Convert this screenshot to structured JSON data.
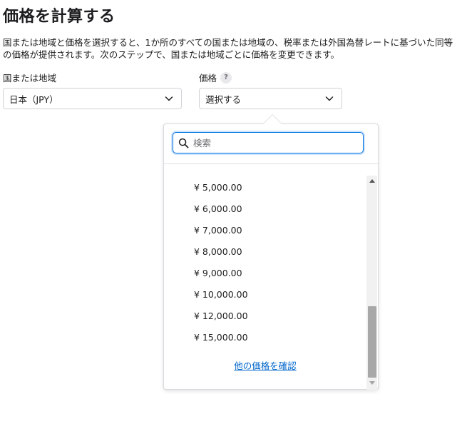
{
  "page": {
    "title": "価格を計算する",
    "description": "国または地域と価格を選択すると、1か所のすべての国または地域の、税率または外国為替レートに基づいた同等の価格が提供されます。次のステップで、国または地域ごとに価格を変更できます。"
  },
  "country_field": {
    "label": "国または地域",
    "value": "日本（JPY）"
  },
  "price_field": {
    "label": "価格",
    "help": "?",
    "value": "選択する"
  },
  "dropdown": {
    "search_placeholder": "検索",
    "items": [
      "¥ 5,000.00",
      "¥ 6,000.00",
      "¥ 7,000.00",
      "¥ 8,000.00",
      "¥ 9,000.00",
      "¥ 10,000.00",
      "¥ 12,000.00",
      "¥ 15,000.00"
    ],
    "more_link": "他の価格を確認"
  },
  "colors": {
    "accent": "#0071e3",
    "link": "#0066cc",
    "text": "#1d1d1f",
    "border": "#d2d2d7"
  }
}
